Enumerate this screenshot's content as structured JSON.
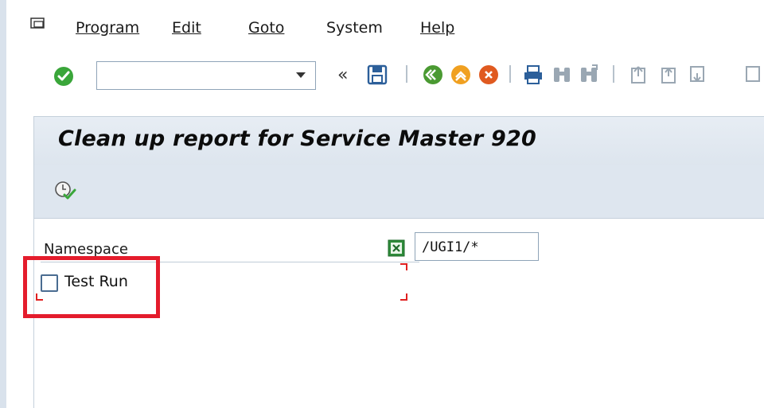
{
  "menubar": {
    "items": [
      {
        "label": "Program"
      },
      {
        "label": "Edit"
      },
      {
        "label": "Goto"
      },
      {
        "label": "System"
      },
      {
        "label": "Help"
      }
    ]
  },
  "toolbar": {
    "command_field_value": "",
    "back_glyph": "«"
  },
  "title": "Clean up report for Service Master 920",
  "form": {
    "namespace_label": "Namespace",
    "namespace_value": "/UGI1/*",
    "test_run_label": "Test Run",
    "test_run_checked": false
  },
  "colors": {
    "highlight": "#e41c2c",
    "accent_green": "#3aa63a",
    "title_bar": "#e3eaf2"
  },
  "icons": {
    "menu": "menu-icon",
    "ok": "check-circle-icon",
    "save": "save-icon",
    "back": "back-icon",
    "exit": "exit-icon",
    "cancel": "cancel-icon",
    "print": "print-icon",
    "find": "find-icon",
    "find_next": "find-next-icon",
    "first_page": "first-page-icon",
    "prev_page": "previous-page-icon",
    "next_page": "next-page-icon",
    "execute": "execute-icon",
    "multiple_selection": "multiple-selection-icon"
  }
}
